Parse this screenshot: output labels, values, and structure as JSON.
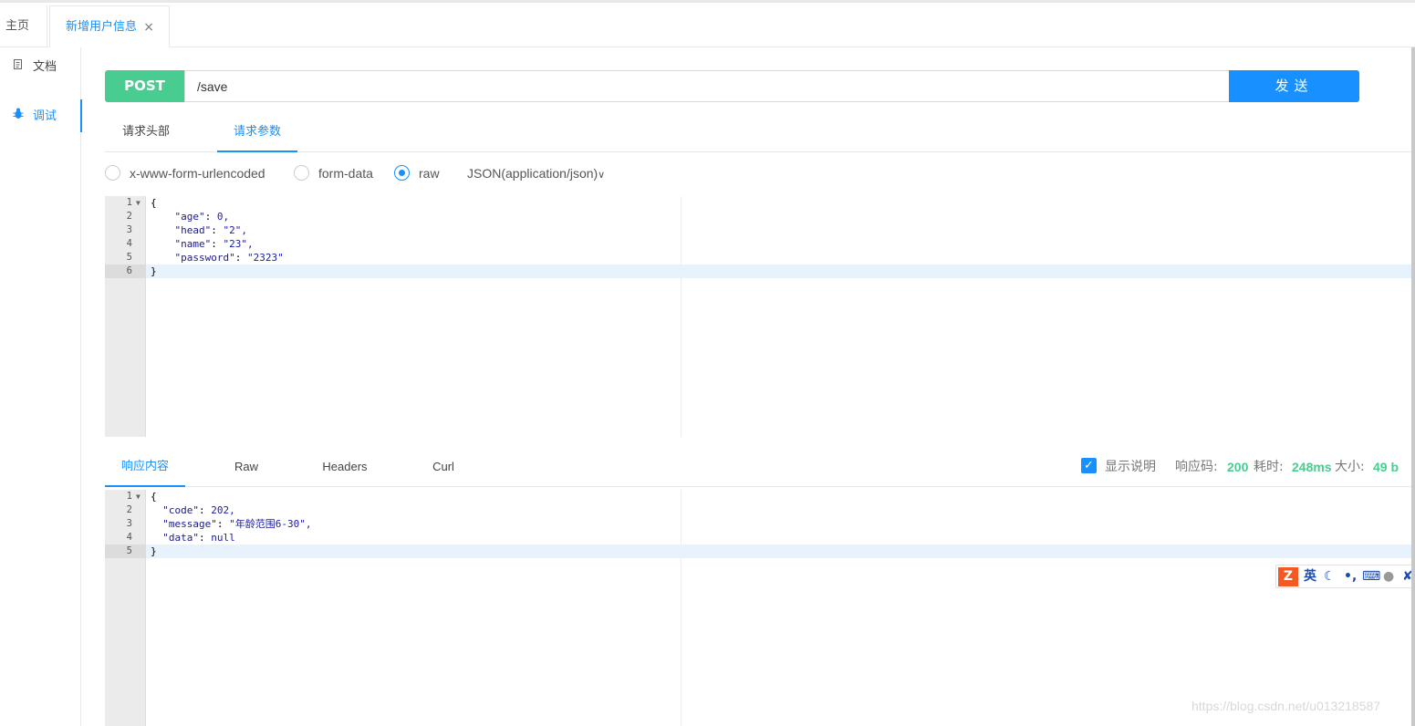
{
  "tabs": {
    "home": "主页",
    "active": "新增用户信息",
    "close_glyph": "×"
  },
  "nav": {
    "doc_label": "文档",
    "debug_label": "调试"
  },
  "request": {
    "method": "POST",
    "url": "/save",
    "send_label": "发送"
  },
  "request_tabs": [
    "请求头部",
    "请求参数"
  ],
  "body_types": {
    "options": [
      "x-www-form-urlencoded",
      "form-data",
      "raw"
    ],
    "selected": "raw",
    "content_type": "JSON(application/json)"
  },
  "request_body": [
    {
      "num": "1",
      "text": "{",
      "fold": true
    },
    {
      "num": "2",
      "key": "\"age\"",
      "val": "0,",
      "indent": "    "
    },
    {
      "num": "3",
      "key": "\"head\"",
      "val": "\"2\",",
      "indent": "    "
    },
    {
      "num": "4",
      "key": "\"name\"",
      "val": "\"23\",",
      "indent": "    "
    },
    {
      "num": "5",
      "key": "\"password\"",
      "val": "\"2323\"",
      "indent": "    "
    },
    {
      "num": "6",
      "text": "}",
      "active": true
    }
  ],
  "response_tabs": [
    "响应内容",
    "Raw",
    "Headers",
    "Curl"
  ],
  "response_status": {
    "show_desc_label": "显示说明",
    "code_label": "响应码:",
    "code": "200",
    "time_label": "耗时:",
    "time": "248ms",
    "size_label": "大小:",
    "size": "49 b"
  },
  "response_body": [
    {
      "num": "1",
      "text": "{",
      "fold": true
    },
    {
      "num": "2",
      "key": "\"code\"",
      "val": "202,",
      "indent": "  "
    },
    {
      "num": "3",
      "key": "\"message\"",
      "val": "\"年龄范围6-30\",",
      "indent": "  "
    },
    {
      "num": "4",
      "key": "\"data\"",
      "val": "null",
      "indent": "  "
    },
    {
      "num": "5",
      "text": "}",
      "active": true
    }
  ],
  "ime": {
    "logo": "Z",
    "lang": "英"
  },
  "watermark": "https://blog.csdn.net/u013218587",
  "colors": {
    "accent": "#1890ff",
    "post": "#49cc90",
    "status_green": "#49cc90"
  }
}
